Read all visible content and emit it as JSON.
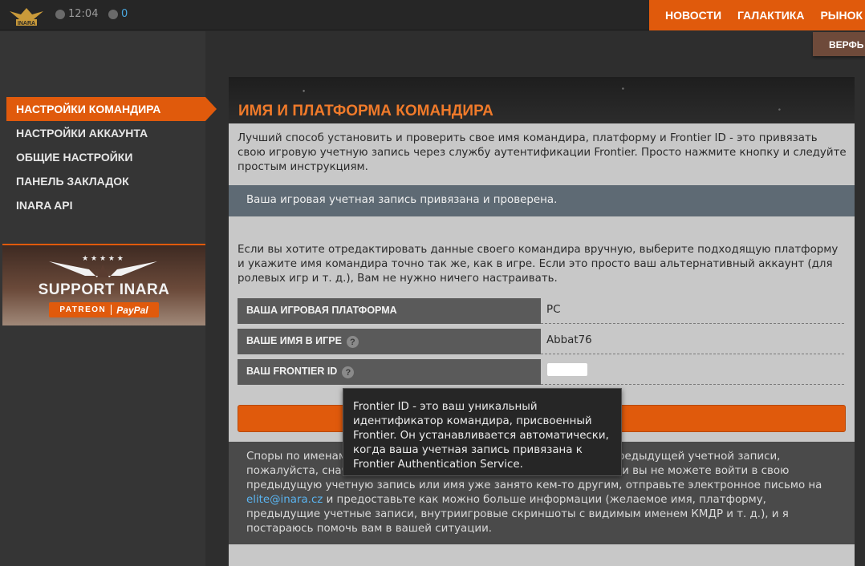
{
  "topbar": {
    "logo_text": "INARA",
    "time": "12:04",
    "users_count": "0",
    "nav": [
      "НОВОСТИ",
      "ГАЛАКТИКА",
      "РЫНОК"
    ],
    "subnav": "ВЕРФЬ"
  },
  "sidebar": {
    "items": [
      {
        "label": "НАСТРОЙКИ КОМАНДИРА",
        "active": true
      },
      {
        "label": "НАСТРОЙКИ АККАУНТА",
        "active": false
      },
      {
        "label": "ОБЩИЕ НАСТРОЙКИ",
        "active": false
      },
      {
        "label": "ПАНЕЛЬ ЗАКЛАДОК",
        "active": false
      },
      {
        "label": "INARA API",
        "active": false
      }
    ],
    "support": {
      "title": "SUPPORT INARA",
      "patreon": "PATREON",
      "paypal": "PayPal"
    }
  },
  "main": {
    "title": "ИМЯ И ПЛАТФОРМА КОМАНДИРА",
    "intro": "Лучший способ установить и проверить свое имя командира, платформу и Frontier ID - это привязать свою игровую учетную запись через службу аутентификации Frontier. Просто нажмите кнопку и следуйте простым инструкциям.",
    "verified": "Ваша игровая учетная запись привязана и проверена.",
    "edit_text": "Если вы хотите отредактировать данные своего командира вручную, выберите подходящую платформу и укажите имя командира точно так же, как в игре. Если это просто ваш альтернативный аккаунт (для ролевых игр и т. д.), Вам не нужно ничего настраивать.",
    "fields": [
      {
        "label": "ВАША ИГРОВАЯ ПЛАТФОРМА",
        "value": "PC",
        "help": false
      },
      {
        "label": "ВАШЕ ИМЯ В ИГРЕ",
        "value": "Abbat76",
        "help": true
      },
      {
        "label": "ВАШ FRONTIER ID",
        "value": "",
        "help": true
      }
    ],
    "footer": {
      "part1": "Споры по именам: если вы не можете получить доступ к своей предыдущей учетной записи, пожалуйста, сначала попробуйте восстановить к ней доступ. Если вы не можете войти в свою предыдущую учетную запись или имя уже занято кем-то другим, отправьте электронное письмо на ",
      "email": "elite@inara.cz",
      "part2": " и предоставьте как можно больше информации (желаемое имя, платформу, предыдущие учетные записи, внутриигровые скриншоты с видимым именем КМДР и т. д.), и я постараюсь помочь вам в вашей ситуации."
    }
  },
  "tooltip": {
    "text": "Frontier ID - это ваш уникальный идентификатор командира, присвоенный Frontier. Он устанавливается автоматически, когда ваша учетная запись привязана к Frontier Authentication Service."
  },
  "colors": {
    "accent": "#e05a0c",
    "title": "#f07a2a",
    "link": "#5ab4f0"
  }
}
